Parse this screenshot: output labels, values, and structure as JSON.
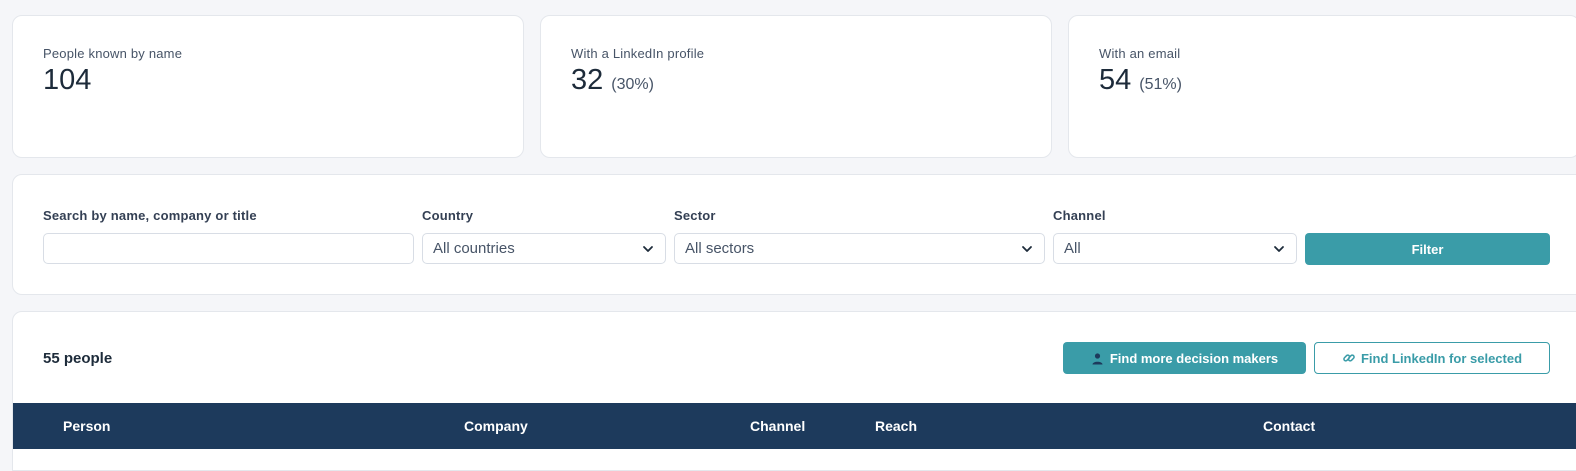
{
  "stats": [
    {
      "label": "People known by name",
      "value": "104",
      "pct": ""
    },
    {
      "label": "With a LinkedIn profile",
      "value": "32",
      "pct": "(30%)"
    },
    {
      "label": "With an email",
      "value": "54",
      "pct": "(51%)"
    }
  ],
  "filters": {
    "search_label": "Search by name, company or title",
    "search_value": "",
    "country_label": "Country",
    "country_value": "All countries",
    "sector_label": "Sector",
    "sector_value": "All sectors",
    "channel_label": "Channel",
    "channel_value": "All",
    "filter_button": "Filter"
  },
  "results": {
    "count": "55 people",
    "find_decision_makers": "Find more decision makers",
    "find_linkedin": "Find LinkedIn for selected",
    "columns": [
      "Person",
      "Company",
      "Channel",
      "Reach",
      "Contact"
    ]
  },
  "colors": {
    "accent": "#3a9ca8",
    "header_bg": "#1d3a5c"
  }
}
